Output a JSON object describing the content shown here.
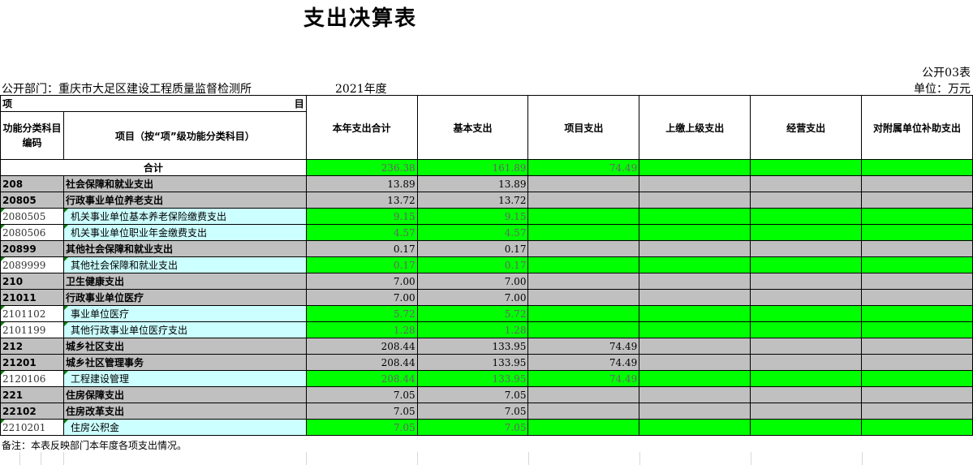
{
  "title": "支出决算表",
  "table_code": "公开03表",
  "dept_label": "公开部门：重庆市大足区建设工程质量监督检测所",
  "year": "2021年度",
  "unit": "单位：万元",
  "header": {
    "xiang": "项",
    "mu": "目",
    "code": "功能分类科目编码",
    "name": "项目（按“项”级功能分类科目）",
    "cols": [
      "本年支出合计",
      "基本支出",
      "项目支出",
      "上缴上级支出",
      "经营支出",
      "对附属单位补助支出"
    ]
  },
  "total": {
    "label": "合计",
    "values": [
      "236.38",
      "161.89",
      "74.49",
      "",
      "",
      ""
    ]
  },
  "rows": [
    {
      "code": "208",
      "name": "社会保障和就业支出",
      "level": 1,
      "values": [
        "13.89",
        "13.89",
        "",
        "",
        "",
        ""
      ]
    },
    {
      "code": "20805",
      "name": "行政事业单位养老支出",
      "level": 2,
      "values": [
        "13.72",
        "13.72",
        "",
        "",
        "",
        ""
      ]
    },
    {
      "code": "2080505",
      "name": "机关事业单位基本养老保险缴费支出",
      "level": 3,
      "values": [
        "9.15",
        "9.15",
        "",
        "",
        "",
        ""
      ]
    },
    {
      "code": "2080506",
      "name": "机关事业单位职业年金缴费支出",
      "level": 3,
      "values": [
        "4.57",
        "4.57",
        "",
        "",
        "",
        ""
      ]
    },
    {
      "code": "20899",
      "name": "其他社会保障和就业支出",
      "level": 2,
      "values": [
        "0.17",
        "0.17",
        "",
        "",
        "",
        ""
      ]
    },
    {
      "code": "2089999",
      "name": "其他社会保障和就业支出",
      "level": 3,
      "values": [
        "0.17",
        "0.17",
        "",
        "",
        "",
        ""
      ]
    },
    {
      "code": "210",
      "name": "卫生健康支出",
      "level": 1,
      "values": [
        "7.00",
        "7.00",
        "",
        "",
        "",
        ""
      ]
    },
    {
      "code": "21011",
      "name": "行政事业单位医疗",
      "level": 2,
      "values": [
        "7.00",
        "7.00",
        "",
        "",
        "",
        ""
      ]
    },
    {
      "code": "2101102",
      "name": "事业单位医疗",
      "level": 3,
      "values": [
        "5.72",
        "5.72",
        "",
        "",
        "",
        ""
      ]
    },
    {
      "code": "2101199",
      "name": "其他行政事业单位医疗支出",
      "level": 3,
      "values": [
        "1.28",
        "1.28",
        "",
        "",
        "",
        ""
      ]
    },
    {
      "code": "212",
      "name": "城乡社区支出",
      "level": 1,
      "values": [
        "208.44",
        "133.95",
        "74.49",
        "",
        "",
        ""
      ]
    },
    {
      "code": "21201",
      "name": "城乡社区管理事务",
      "level": 2,
      "values": [
        "208.44",
        "133.95",
        "74.49",
        "",
        "",
        ""
      ]
    },
    {
      "code": "2120106",
      "name": "工程建设管理",
      "level": 3,
      "values": [
        "208.44",
        "133.95",
        "74.49",
        "",
        "",
        ""
      ]
    },
    {
      "code": "221",
      "name": "住房保障支出",
      "level": 1,
      "values": [
        "7.05",
        "7.05",
        "",
        "",
        "",
        ""
      ]
    },
    {
      "code": "22102",
      "name": "住房改革支出",
      "level": 2,
      "values": [
        "7.05",
        "7.05",
        "",
        "",
        "",
        ""
      ]
    },
    {
      "code": "2210201",
      "name": "住房公积金",
      "level": 3,
      "values": [
        "7.05",
        "7.05",
        "",
        "",
        "",
        ""
      ]
    }
  ],
  "note": "备注：本表反映部门本年度各项支出情况。"
}
